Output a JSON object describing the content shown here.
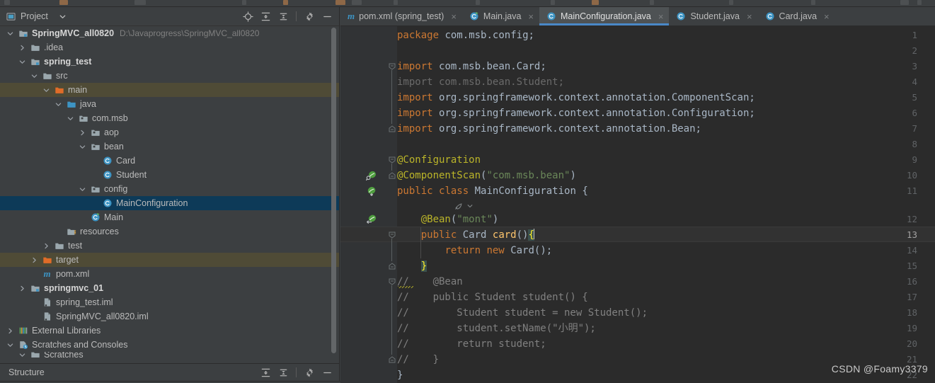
{
  "window": {
    "theme_bg": "#3c3f41",
    "editor_bg": "#2b2b2b",
    "accent": "#4a88c7",
    "selection_bg": "#0d3a58",
    "modified_row_bg": "#4f4b36"
  },
  "project_panel": {
    "title": "Project",
    "title_icon": "project-view-icon",
    "dropdown_icon": "chevron-down-icon",
    "actions": [
      {
        "name": "locate-file-icon",
        "label": "Select Opened File"
      },
      {
        "name": "expand-all-icon",
        "label": "Expand All"
      },
      {
        "name": "collapse-all-icon",
        "label": "Collapse All"
      },
      {
        "name": "gear-icon",
        "label": "Settings"
      },
      {
        "name": "minimize-icon",
        "label": "Hide"
      }
    ],
    "tree": [
      {
        "indent": 0,
        "arrow": "down",
        "icon": "module-icon",
        "label": "SpringMVC_all0820",
        "bold": true,
        "hint": "D:\\Javaprogress\\SpringMVC_all0820",
        "state": "normal"
      },
      {
        "indent": 1,
        "arrow": "right",
        "icon": "folder-icon",
        "label": ".idea",
        "bold": false,
        "hint": "",
        "state": "normal"
      },
      {
        "indent": 1,
        "arrow": "down",
        "icon": "module-icon",
        "label": "spring_test",
        "bold": true,
        "hint": "",
        "state": "normal"
      },
      {
        "indent": 2,
        "arrow": "down",
        "icon": "folder-icon",
        "label": "src",
        "bold": false,
        "hint": "",
        "state": "normal"
      },
      {
        "indent": 3,
        "arrow": "down",
        "icon": "source-root-icon",
        "label": "main",
        "bold": false,
        "hint": "",
        "state": "modified"
      },
      {
        "indent": 4,
        "arrow": "down",
        "icon": "source-java-icon",
        "label": "java",
        "bold": false,
        "hint": "",
        "state": "normal"
      },
      {
        "indent": 5,
        "arrow": "down",
        "icon": "package-icon",
        "label": "com.msb",
        "bold": false,
        "hint": "",
        "state": "normal"
      },
      {
        "indent": 6,
        "arrow": "right",
        "icon": "package-icon",
        "label": "aop",
        "bold": false,
        "hint": "",
        "state": "normal"
      },
      {
        "indent": 6,
        "arrow": "down",
        "icon": "package-icon",
        "label": "bean",
        "bold": false,
        "hint": "",
        "state": "normal"
      },
      {
        "indent": 7,
        "arrow": "none",
        "icon": "class-icon",
        "label": "Card",
        "bold": false,
        "hint": "",
        "state": "normal"
      },
      {
        "indent": 7,
        "arrow": "none",
        "icon": "class-icon",
        "label": "Student",
        "bold": false,
        "hint": "",
        "state": "normal"
      },
      {
        "indent": 6,
        "arrow": "down",
        "icon": "package-icon",
        "label": "config",
        "bold": false,
        "hint": "",
        "state": "normal"
      },
      {
        "indent": 7,
        "arrow": "none",
        "icon": "class-icon",
        "label": "MainConfiguration",
        "bold": false,
        "hint": "",
        "state": "selected"
      },
      {
        "indent": 6,
        "arrow": "none",
        "icon": "runnable-class-icon",
        "label": "Main",
        "bold": false,
        "hint": "",
        "state": "normal"
      },
      {
        "indent": 4,
        "arrow": "none",
        "icon": "resource-root-icon",
        "label": "resources",
        "bold": false,
        "hint": "",
        "state": "normal"
      },
      {
        "indent": 3,
        "arrow": "right",
        "icon": "folder-icon",
        "label": "test",
        "bold": false,
        "hint": "",
        "state": "normal"
      },
      {
        "indent": 2,
        "arrow": "right",
        "icon": "excluded-folder-icon",
        "label": "target",
        "bold": false,
        "hint": "",
        "state": "modified"
      },
      {
        "indent": 2,
        "arrow": "none",
        "icon": "maven-icon",
        "label": "pom.xml",
        "bold": false,
        "hint": "",
        "state": "normal"
      },
      {
        "indent": 1,
        "arrow": "right",
        "icon": "module-icon",
        "label": "springmvc_01",
        "bold": true,
        "hint": "",
        "state": "normal"
      },
      {
        "indent": 2,
        "arrow": "none",
        "icon": "iml-icon",
        "label": "spring_test.iml",
        "bold": false,
        "hint": "",
        "state": "normal"
      },
      {
        "indent": 2,
        "arrow": "none",
        "icon": "iml-icon",
        "label": "SpringMVC_all0820.iml",
        "bold": false,
        "hint": "",
        "state": "normal"
      },
      {
        "indent": 0,
        "arrow": "right",
        "icon": "libraries-icon",
        "label": "External Libraries",
        "bold": false,
        "hint": "",
        "state": "normal"
      },
      {
        "indent": 0,
        "arrow": "down",
        "icon": "scratches-icon",
        "label": "Scratches and Consoles",
        "bold": false,
        "hint": "",
        "state": "normal"
      },
      {
        "indent": 1,
        "arrow": "down",
        "icon": "folder-icon",
        "label": "Scratches",
        "bold": false,
        "hint": "",
        "state": "clipped"
      }
    ]
  },
  "structure_panel": {
    "title": "Structure",
    "actions": [
      {
        "name": "expand-all-icon",
        "label": "Expand All"
      },
      {
        "name": "collapse-all-icon",
        "label": "Collapse All"
      },
      {
        "name": "gear-icon",
        "label": "Settings"
      },
      {
        "name": "minimize-icon",
        "label": "Hide"
      }
    ]
  },
  "editor": {
    "tabs": [
      {
        "label": "pom.xml (spring_test)",
        "icon": "maven-icon",
        "active": false,
        "close": "×"
      },
      {
        "label": "Main.java",
        "icon": "runnable-class-icon",
        "active": false,
        "close": "×"
      },
      {
        "label": "MainConfiguration.java",
        "icon": "class-icon",
        "active": true,
        "close": "×"
      },
      {
        "label": "Student.java",
        "icon": "class-icon",
        "active": false,
        "close": "×"
      },
      {
        "label": "Card.java",
        "icon": "class-icon",
        "active": false,
        "close": "×"
      }
    ],
    "caret_line": 13,
    "intention_hint": {
      "icon": "spring-intention-icon",
      "chevron": "chevron-down-icon"
    },
    "gutter_marks": [
      {
        "line": 10,
        "icon": "spring-bean-search-icon"
      },
      {
        "line": 11,
        "icon": "spring-bean-icon"
      },
      {
        "line": 12,
        "icon": "spring-bean-navigate-icon"
      }
    ],
    "lines": [
      {
        "n": 1,
        "text": "package com.msb.config;"
      },
      {
        "n": 2,
        "text": ""
      },
      {
        "n": 3,
        "text": "import com.msb.bean.Card;"
      },
      {
        "n": 4,
        "text": "import com.msb.bean.Student;"
      },
      {
        "n": 5,
        "text": "import org.springframework.context.annotation.ComponentScan;"
      },
      {
        "n": 6,
        "text": "import org.springframework.context.annotation.Configuration;"
      },
      {
        "n": 7,
        "text": "import org.springframework.context.annotation.Bean;"
      },
      {
        "n": 8,
        "text": ""
      },
      {
        "n": 9,
        "text": "@Configuration"
      },
      {
        "n": 10,
        "text": "@ComponentScan(\"com.msb.bean\")"
      },
      {
        "n": 11,
        "text": "public class MainConfiguration {"
      },
      {
        "n": 12,
        "text": "    @Bean(\"mont\")"
      },
      {
        "n": 13,
        "text": "    public Card card(){"
      },
      {
        "n": 14,
        "text": "        return new Card();"
      },
      {
        "n": 15,
        "text": "    }"
      },
      {
        "n": 16,
        "text": "//    @Bean"
      },
      {
        "n": 17,
        "text": "//    public Student student() {"
      },
      {
        "n": 18,
        "text": "//        Student student = new Student();"
      },
      {
        "n": 19,
        "text": "//        student.setName(\"小明\");"
      },
      {
        "n": 20,
        "text": "//        return student;"
      },
      {
        "n": 21,
        "text": "//    }"
      },
      {
        "n": 22,
        "text": "}"
      }
    ]
  },
  "watermark": {
    "text": "CSDN @Foamy3379"
  }
}
